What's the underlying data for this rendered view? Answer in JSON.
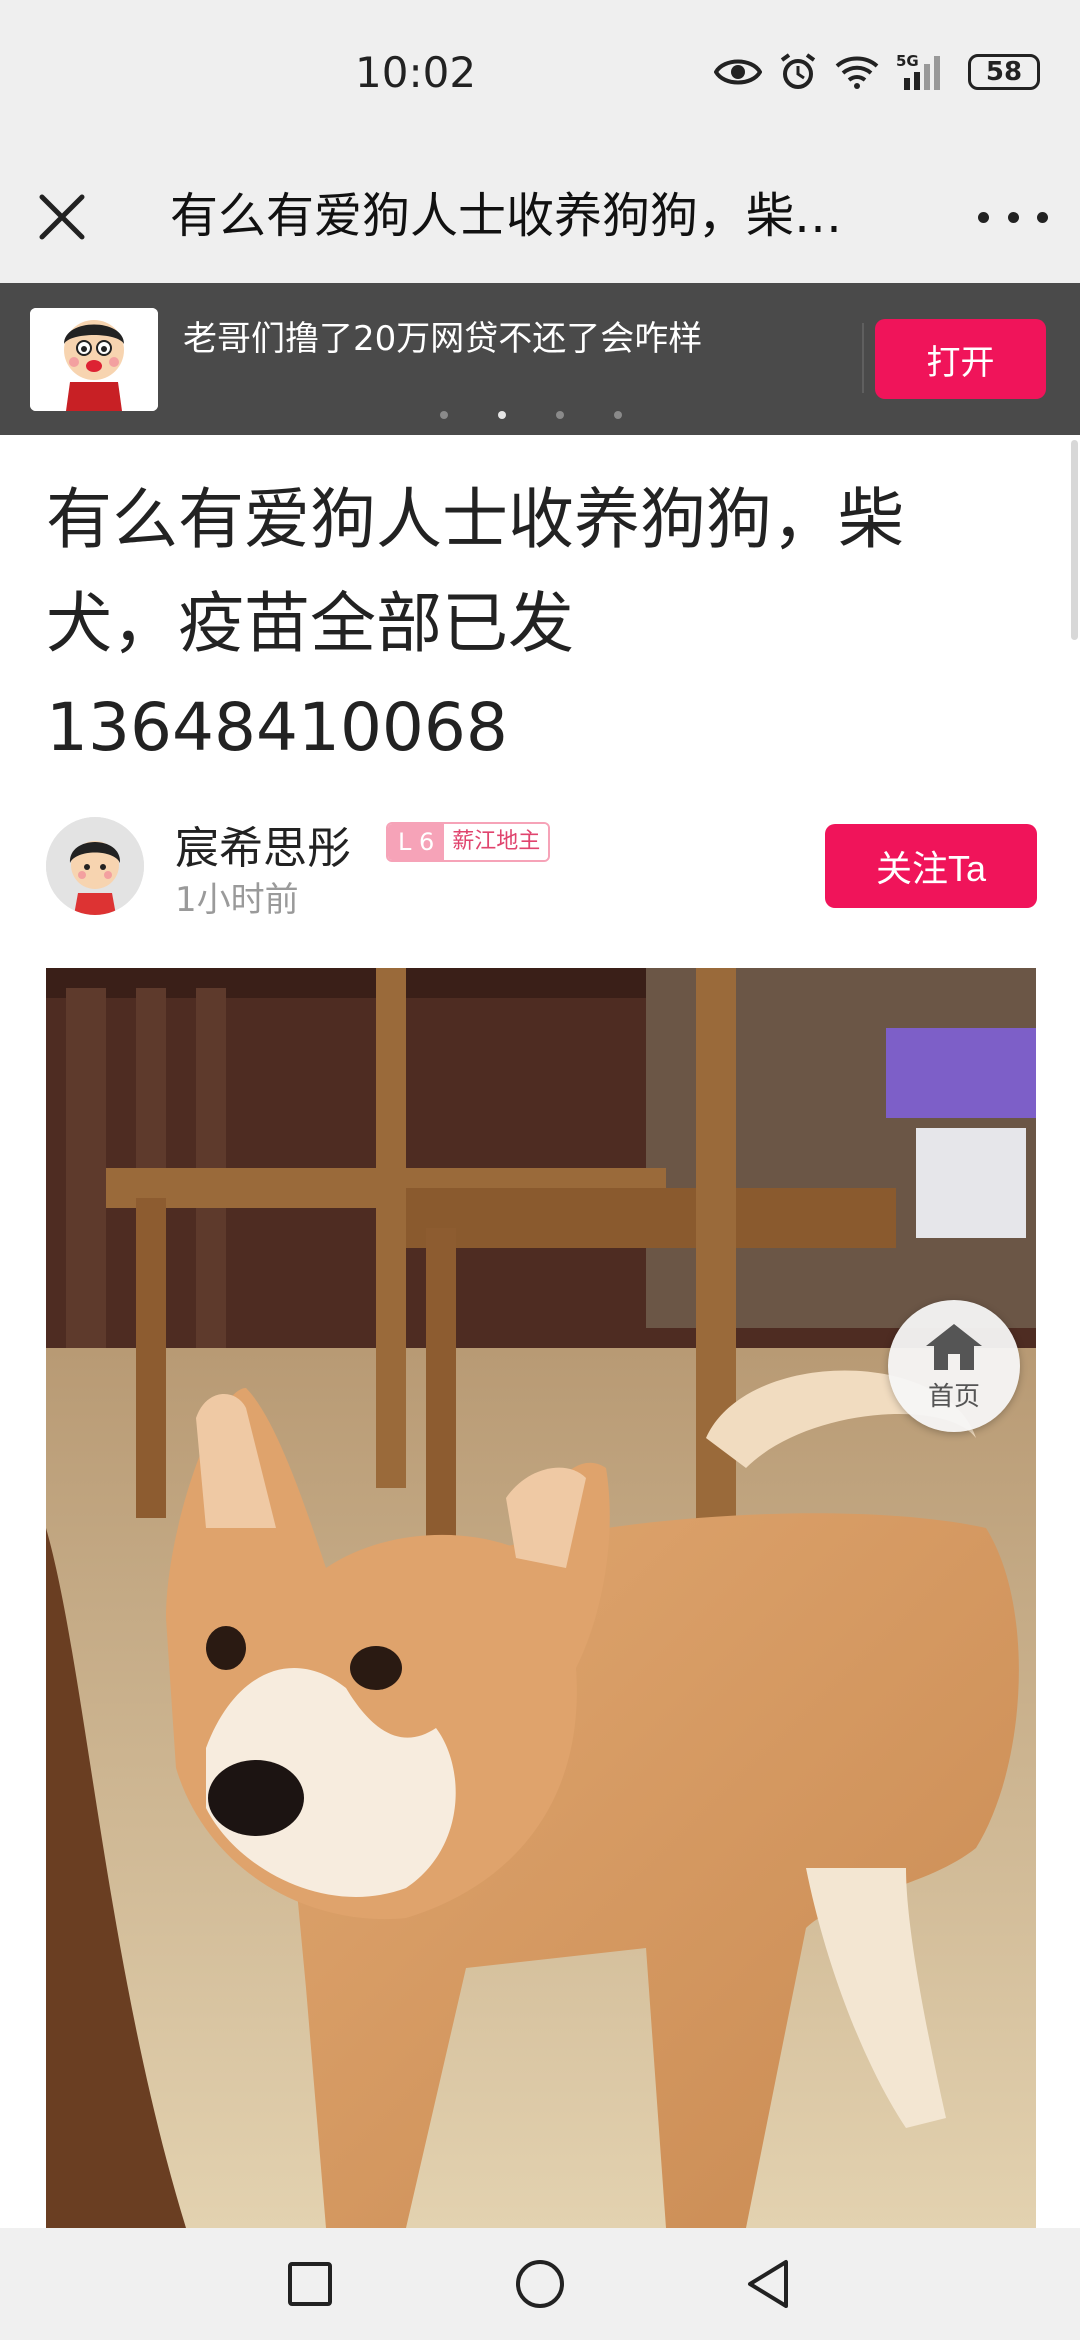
{
  "status_bar": {
    "time": "10:02",
    "battery": "58",
    "network": "5G"
  },
  "title_bar": {
    "title": "有么有爱狗人士收养狗狗，柴…"
  },
  "banner": {
    "text": "老哥们撸了20万网贷不还了会咋样",
    "open_label": "打开",
    "dots": 4,
    "active_dot": 1
  },
  "post": {
    "title_lines": [
      "有么有爱狗人士收养狗狗，柴",
      "犬，疫苗全部已发",
      "13648410068"
    ],
    "author": {
      "name": "宸希思彤",
      "level": "L 6",
      "rank": "薪江地主",
      "time": "1小时前"
    },
    "follow_label": "关注Ta"
  },
  "floating": {
    "home_label": "首页"
  },
  "colors": {
    "accent": "#f0145a",
    "banner_bg": "#4a4a4a",
    "statusbar_bg": "#efefef"
  }
}
